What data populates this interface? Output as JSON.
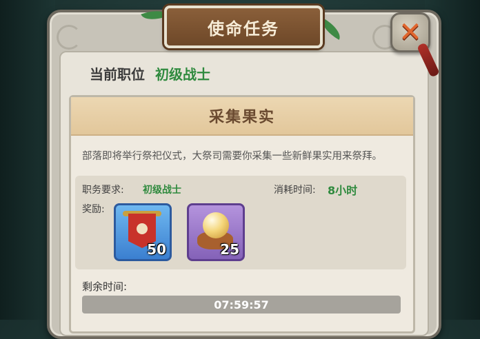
{
  "dialog": {
    "title": "使命任务",
    "close_icon": "close-x-icon"
  },
  "position": {
    "label": "当前职位",
    "value": "初级战士"
  },
  "task": {
    "name": "采集果实",
    "description": "部落即将举行祭祀仪式，大祭司需要你采集一些新鲜果实用来祭拜。",
    "requirement_label": "职务要求:",
    "requirement_value": "初级战士",
    "time_cost_label": "消耗时间:",
    "time_cost_value": "8小时",
    "reward_label": "奖励:",
    "rewards": [
      {
        "icon": "red-banner-icon",
        "count": "50"
      },
      {
        "icon": "pearl-icon",
        "count": "25"
      }
    ],
    "remaining_label": "剩余时间:",
    "remaining_time": "07:59:57"
  },
  "colors": {
    "green_text": "#2f8a3e",
    "title_plaque": "#7a5230",
    "close_accent": "#e0662e"
  }
}
